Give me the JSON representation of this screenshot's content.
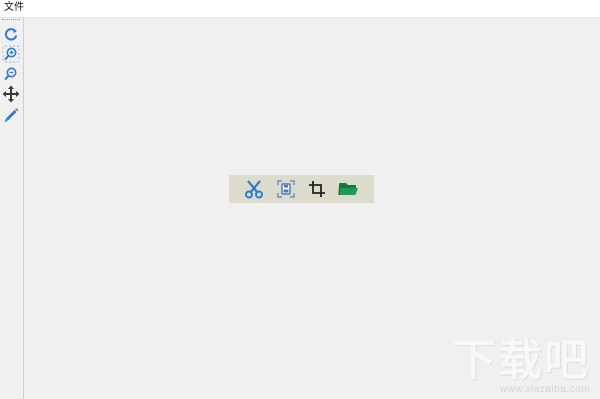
{
  "menu": {
    "file_label": "文件"
  },
  "toolbar": {
    "tools": [
      {
        "name": "rotate",
        "icon": "rotate-icon"
      },
      {
        "name": "zoom-in",
        "icon": "zoom-in-icon"
      },
      {
        "name": "zoom-out",
        "icon": "zoom-out-icon"
      },
      {
        "name": "move",
        "icon": "move-icon"
      },
      {
        "name": "draw",
        "icon": "pencil-icon"
      }
    ]
  },
  "capture_bar": {
    "buttons": [
      {
        "name": "scissors",
        "icon": "scissors-icon",
        "color": "#2f7bd0"
      },
      {
        "name": "save",
        "icon": "save-icon",
        "color": "#6a8fc0"
      },
      {
        "name": "crop",
        "icon": "crop-icon",
        "color": "#222222"
      },
      {
        "name": "folder",
        "icon": "folder-icon",
        "color": "#1f9a55"
      }
    ]
  },
  "watermark": {
    "main": "下载吧",
    "sub": "www.xiazaiba.com"
  },
  "colors": {
    "accent": "#2f7bd0",
    "folder": "#1f9a55",
    "background": "#f0f0f0",
    "float_bar": "#dcdccc"
  }
}
